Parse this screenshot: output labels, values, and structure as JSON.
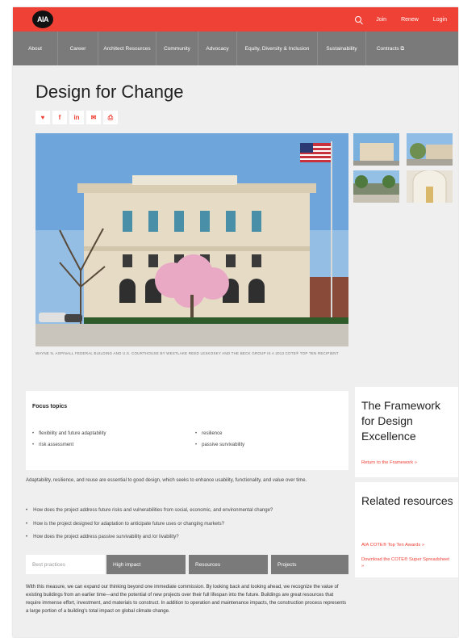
{
  "header": {
    "logo": "AIA",
    "links": [
      "Join",
      "Renew",
      "Login"
    ]
  },
  "nav": {
    "items": [
      {
        "label": "About",
        "w": 56
      },
      {
        "label": "Career",
        "w": 50
      },
      {
        "label": "Architect Resources",
        "w": 72
      },
      {
        "label": "Community",
        "w": 52
      },
      {
        "label": "Advocacy",
        "w": 48
      },
      {
        "label": "Equity, Diversity & Inclusion",
        "w": 100
      },
      {
        "label": "Sustainability",
        "w": 60
      },
      {
        "label": "Contracts ⧉",
        "w": 60
      }
    ]
  },
  "page": {
    "title": "Design for Change",
    "caption": "WAYNE N. ASPINALL FEDERAL BUILDING AND U.S. COURTHOUSE BY WESTLAKE REED LESKOSKY AND THE BECK GROUP IS A 2013 COTE® TOP TEN RECIPIENT"
  },
  "share": [
    {
      "name": "twitter-icon",
      "glyph": "♥"
    },
    {
      "name": "facebook-icon",
      "glyph": "f"
    },
    {
      "name": "linkedin-icon",
      "glyph": "in"
    },
    {
      "name": "email-icon",
      "glyph": "✉"
    },
    {
      "name": "print-icon",
      "glyph": "⎙"
    }
  ],
  "focus": {
    "title": "Focus topics",
    "items": [
      "flexibility and future adaptability",
      "resilience",
      "risk assessment",
      "passive survivability"
    ]
  },
  "intro": "Adaptability, resilience, and reuse are essential to good design, which seeks to enhance usability, functionality, and value over time.",
  "questions": [
    "How does the project address future risks and vulnerabilities from social, economic, and environmental change?",
    "How is the project designed for adaptation to anticipate future uses or changing markets?",
    "How does the project address passive survivability and /or livability?"
  ],
  "tabs": [
    "Best practices",
    "High impact",
    "Resources",
    "Projects"
  ],
  "body": "With this measure, we can expand our thinking beyond one immediate commission. By looking back and looking ahead, we recognize the value of existing buildings from an earlier time—and the potential of new projects over their full lifespan into the future. Buildings are great resources that require immense effort, investment, and materials to construct. In addition to operation and maintenance impacts, the construction process represents a large portion of a building's total impact on global climate change.",
  "sidebar": {
    "framework": {
      "heading": "The Framework for Design Excellence",
      "link": "Return to the Framework »"
    },
    "related": {
      "heading": "Related resources",
      "links": [
        "AIA COTE® Top Ten Awards »",
        "Download the COTE® Super Spreadsheet »"
      ]
    }
  }
}
